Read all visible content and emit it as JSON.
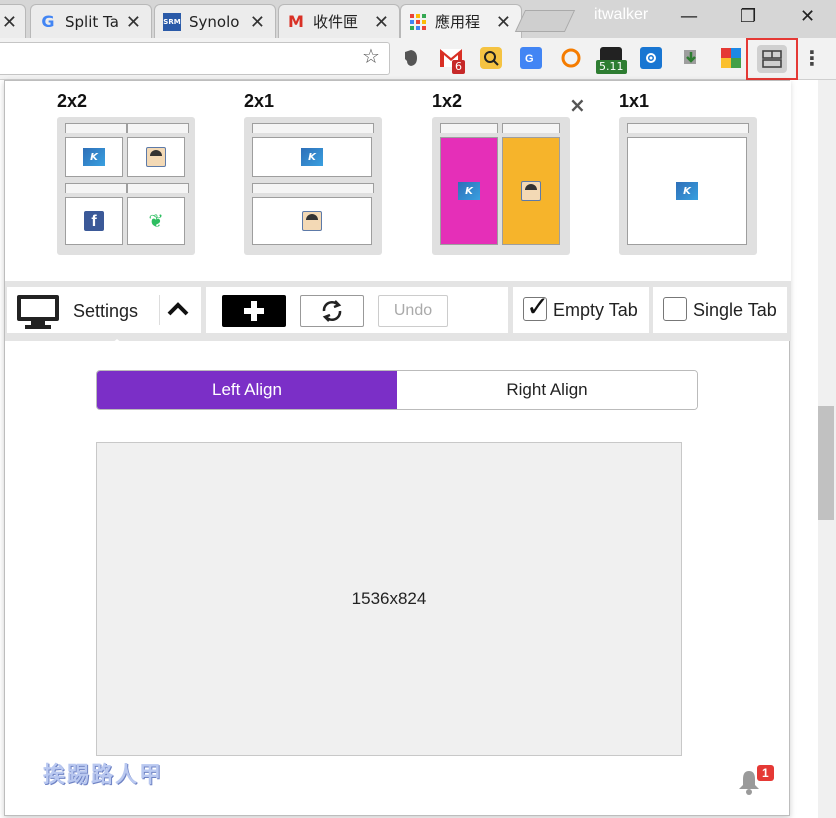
{
  "browser": {
    "tabs": [
      {
        "title": "",
        "favicon": "close-only"
      },
      {
        "title": "Split Ta",
        "favicon": "google-icon"
      },
      {
        "title": "Synolo",
        "favicon": "srm-icon"
      },
      {
        "title": "收件匣",
        "favicon": "gmail-icon"
      },
      {
        "title": "應用程",
        "favicon": "apps-grid-icon"
      }
    ],
    "favicon_texts": {
      "srm": "SRM",
      "gmail": "M",
      "google": "G"
    },
    "user_name": "itwalker",
    "window_controls": {
      "minimize": "—",
      "restore": "❐",
      "close": "✕"
    },
    "toolbar": {
      "star": "☆",
      "menu": "⋮",
      "extensions": [
        {
          "name": "evernote-icon",
          "badge": ""
        },
        {
          "name": "gmail-checker-icon",
          "badge": "6"
        },
        {
          "name": "search-ext-icon",
          "badge": ""
        },
        {
          "name": "translate-icon",
          "badge": ""
        },
        {
          "name": "b-ext-icon",
          "badge": ""
        },
        {
          "name": "terminal-ext-icon",
          "badge": "5.11"
        },
        {
          "name": "settings-ext-icon",
          "badge": ""
        },
        {
          "name": "download-ext-icon",
          "badge": ""
        },
        {
          "name": "puzzle-ext-icon",
          "badge": ""
        },
        {
          "name": "split-screen-icon",
          "badge": ""
        }
      ]
    }
  },
  "popup": {
    "close": "×",
    "layouts": [
      {
        "label": "2x2"
      },
      {
        "label": "2x1"
      },
      {
        "label": "1x2"
      },
      {
        "label": "1x1"
      }
    ],
    "icon_glyphs": {
      "k": "K",
      "fb": "f",
      "ev": "❦"
    },
    "controls": {
      "settings_label": "Settings",
      "caret": "⌃",
      "plus": "✚",
      "refresh": "⟳",
      "undo": "Undo",
      "empty_tab_label": "Empty Tab",
      "empty_tab_checked": true,
      "checkmark": "✓",
      "single_tab_label": "Single Tab",
      "single_tab_checked": false
    },
    "align": {
      "left": "Left Align",
      "right": "Right Align",
      "selected": "left"
    },
    "resolution": "1536x824",
    "watermark": "挨踢路人甲",
    "notifications": {
      "bell": "🔔",
      "count": "1"
    },
    "colors": {
      "accent_purple": "#7b2fc7",
      "pane_magenta": "#e52fb8",
      "pane_orange": "#f6b42b",
      "highlight_red": "#e53935"
    }
  }
}
